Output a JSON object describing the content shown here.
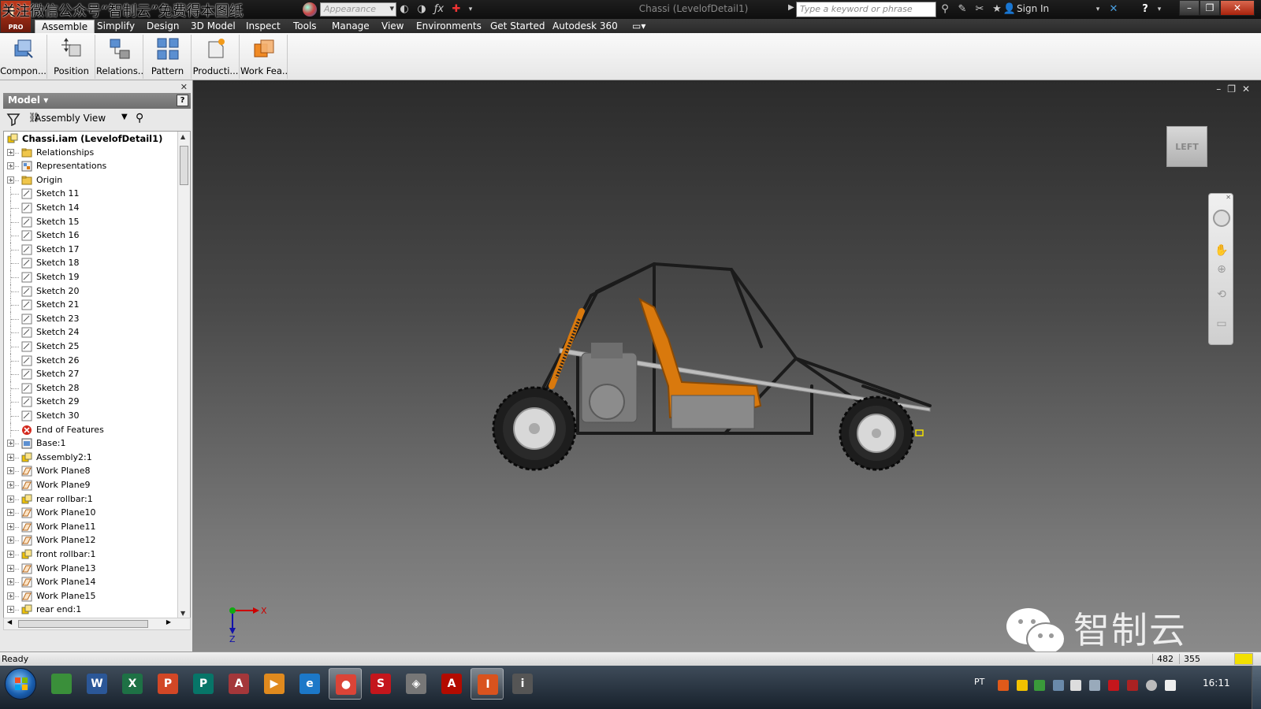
{
  "titlebar": {
    "watermark": "关注微信公众号“智制云”免费得本图纸",
    "logo_sub": "PRO",
    "appearance_placeholder": "Appearance",
    "doc_title": "Chassi (LevelofDetail1)",
    "search_placeholder": "Type a keyword or phrase",
    "sign_in": "Sign In"
  },
  "menu": {
    "tabs": [
      "Assemble",
      "Simplify",
      "Design",
      "3D Model",
      "Inspect",
      "Tools",
      "Manage",
      "View",
      "Environments",
      "Get Started",
      "Autodesk 360"
    ]
  },
  "ribbon": {
    "buttons": [
      "Compon...",
      "Position",
      "Relations...",
      "Pattern",
      "Producti...",
      "Work Fea..."
    ]
  },
  "browser": {
    "header": "Model",
    "help": "?",
    "view_mode": "Assembly View",
    "root": "Chassi.iam (LevelofDetail1)",
    "items": [
      {
        "label": "Relationships",
        "icon": "folder-icon",
        "expandable": true
      },
      {
        "label": "Representations",
        "icon": "representations-icon",
        "expandable": true
      },
      {
        "label": "Origin",
        "icon": "folder-icon",
        "expandable": true
      },
      {
        "label": "Sketch 11",
        "icon": "sketch-icon",
        "expandable": false
      },
      {
        "label": "Sketch 14",
        "icon": "sketch-icon",
        "expandable": false
      },
      {
        "label": "Sketch 15",
        "icon": "sketch-icon",
        "expandable": false
      },
      {
        "label": "Sketch 16",
        "icon": "sketch-icon",
        "expandable": false
      },
      {
        "label": "Sketch 17",
        "icon": "sketch-icon",
        "expandable": false
      },
      {
        "label": "Sketch 18",
        "icon": "sketch-icon",
        "expandable": false
      },
      {
        "label": "Sketch 19",
        "icon": "sketch-icon",
        "expandable": false
      },
      {
        "label": "Sketch 20",
        "icon": "sketch-icon",
        "expandable": false
      },
      {
        "label": "Sketch 21",
        "icon": "sketch-icon",
        "expandable": false
      },
      {
        "label": "Sketch 23",
        "icon": "sketch-icon",
        "expandable": false
      },
      {
        "label": "Sketch 24",
        "icon": "sketch-icon",
        "expandable": false
      },
      {
        "label": "Sketch 25",
        "icon": "sketch-icon",
        "expandable": false
      },
      {
        "label": "Sketch 26",
        "icon": "sketch-icon",
        "expandable": false
      },
      {
        "label": "Sketch 27",
        "icon": "sketch-icon",
        "expandable": false
      },
      {
        "label": "Sketch 28",
        "icon": "sketch-icon",
        "expandable": false
      },
      {
        "label": "Sketch 29",
        "icon": "sketch-icon",
        "expandable": false
      },
      {
        "label": "Sketch 30",
        "icon": "sketch-icon",
        "expandable": false
      },
      {
        "label": "End of Features",
        "icon": "end-of-features-icon",
        "expandable": false
      },
      {
        "label": "Base:1",
        "icon": "part-icon",
        "expandable": true
      },
      {
        "label": "Assembly2:1",
        "icon": "assembly-icon",
        "expandable": true
      },
      {
        "label": "Work Plane8",
        "icon": "work-plane-icon",
        "expandable": true
      },
      {
        "label": "Work Plane9",
        "icon": "work-plane-icon",
        "expandable": true
      },
      {
        "label": "rear rollbar:1",
        "icon": "assembly-icon",
        "expandable": true
      },
      {
        "label": "Work Plane10",
        "icon": "work-plane-icon",
        "expandable": true
      },
      {
        "label": "Work Plane11",
        "icon": "work-plane-icon",
        "expandable": true
      },
      {
        "label": "Work Plane12",
        "icon": "work-plane-icon",
        "expandable": true
      },
      {
        "label": "front rollbar:1",
        "icon": "assembly-icon",
        "expandable": true
      },
      {
        "label": "Work Plane13",
        "icon": "work-plane-icon",
        "expandable": true
      },
      {
        "label": "Work Plane14",
        "icon": "work-plane-icon",
        "expandable": true
      },
      {
        "label": "Work Plane15",
        "icon": "work-plane-icon",
        "expandable": true
      },
      {
        "label": "rear end:1",
        "icon": "assembly-icon",
        "expandable": true
      }
    ]
  },
  "viewport": {
    "viewcube_face": "LEFT",
    "axis_x": "X",
    "axis_z": "Z",
    "watermark": "智制云"
  },
  "status": {
    "text": "Ready",
    "count1": "482",
    "count2": "355",
    "indicator_color": "#f2e000"
  },
  "taskbar": {
    "apps": [
      {
        "name": "explorer-icon",
        "letter": "",
        "color": "#3a8f3a"
      },
      {
        "name": "word-icon",
        "letter": "W",
        "color": "#2b5797"
      },
      {
        "name": "excel-icon",
        "letter": "X",
        "color": "#1e7145"
      },
      {
        "name": "powerpoint-icon",
        "letter": "P",
        "color": "#d24726"
      },
      {
        "name": "publisher-icon",
        "letter": "P",
        "color": "#077568"
      },
      {
        "name": "access-icon",
        "letter": "A",
        "color": "#a4373a"
      },
      {
        "name": "media-player-icon",
        "letter": "▶",
        "color": "#e08a1e"
      },
      {
        "name": "ie-icon",
        "letter": "e",
        "color": "#1c78c8"
      },
      {
        "name": "chrome-icon",
        "letter": "●",
        "color": "#db4437"
      },
      {
        "name": "solidworks-icon",
        "letter": "S",
        "color": "#c4161c"
      },
      {
        "name": "solidworks-explorer-icon",
        "letter": "◈",
        "color": "#777777"
      },
      {
        "name": "acrobat-icon",
        "letter": "A",
        "color": "#b30b00"
      },
      {
        "name": "inventor-icon",
        "letter": "I",
        "color": "#d9531e"
      },
      {
        "name": "inventor-help-icon",
        "letter": "i",
        "color": "#555555"
      }
    ],
    "lang": "PT",
    "clock": "16:11"
  }
}
